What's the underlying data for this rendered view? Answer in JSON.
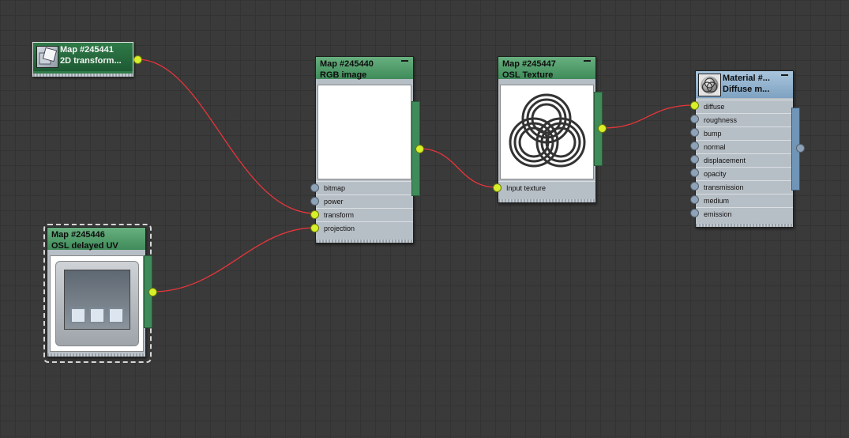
{
  "nodes": {
    "map_245441": {
      "title": "Map #245441",
      "subtitle": "2D transform..."
    },
    "map_245440": {
      "title": "Map #245440",
      "subtitle": "RGB image",
      "slots": [
        "bitmap",
        "power",
        "transform",
        "projection"
      ]
    },
    "map_245447": {
      "title": "Map #245447",
      "subtitle": "OSL Texture",
      "slots": [
        "Input texture"
      ]
    },
    "material": {
      "title": "Material #...",
      "subtitle": "Diffuse m...",
      "slots": [
        "diffuse",
        "roughness",
        "bump",
        "normal",
        "displacement",
        "opacity",
        "transmission",
        "medium",
        "emission"
      ]
    },
    "map_245446": {
      "title": "Map #245446",
      "subtitle": "OSL delayed UV"
    }
  },
  "colors": {
    "wire": "#e8353a",
    "port_connected": "#d8f02a",
    "port_empty": "#8ea2b8",
    "header_green": "#4f9a6a",
    "header_blue": "#8fb0cd"
  }
}
